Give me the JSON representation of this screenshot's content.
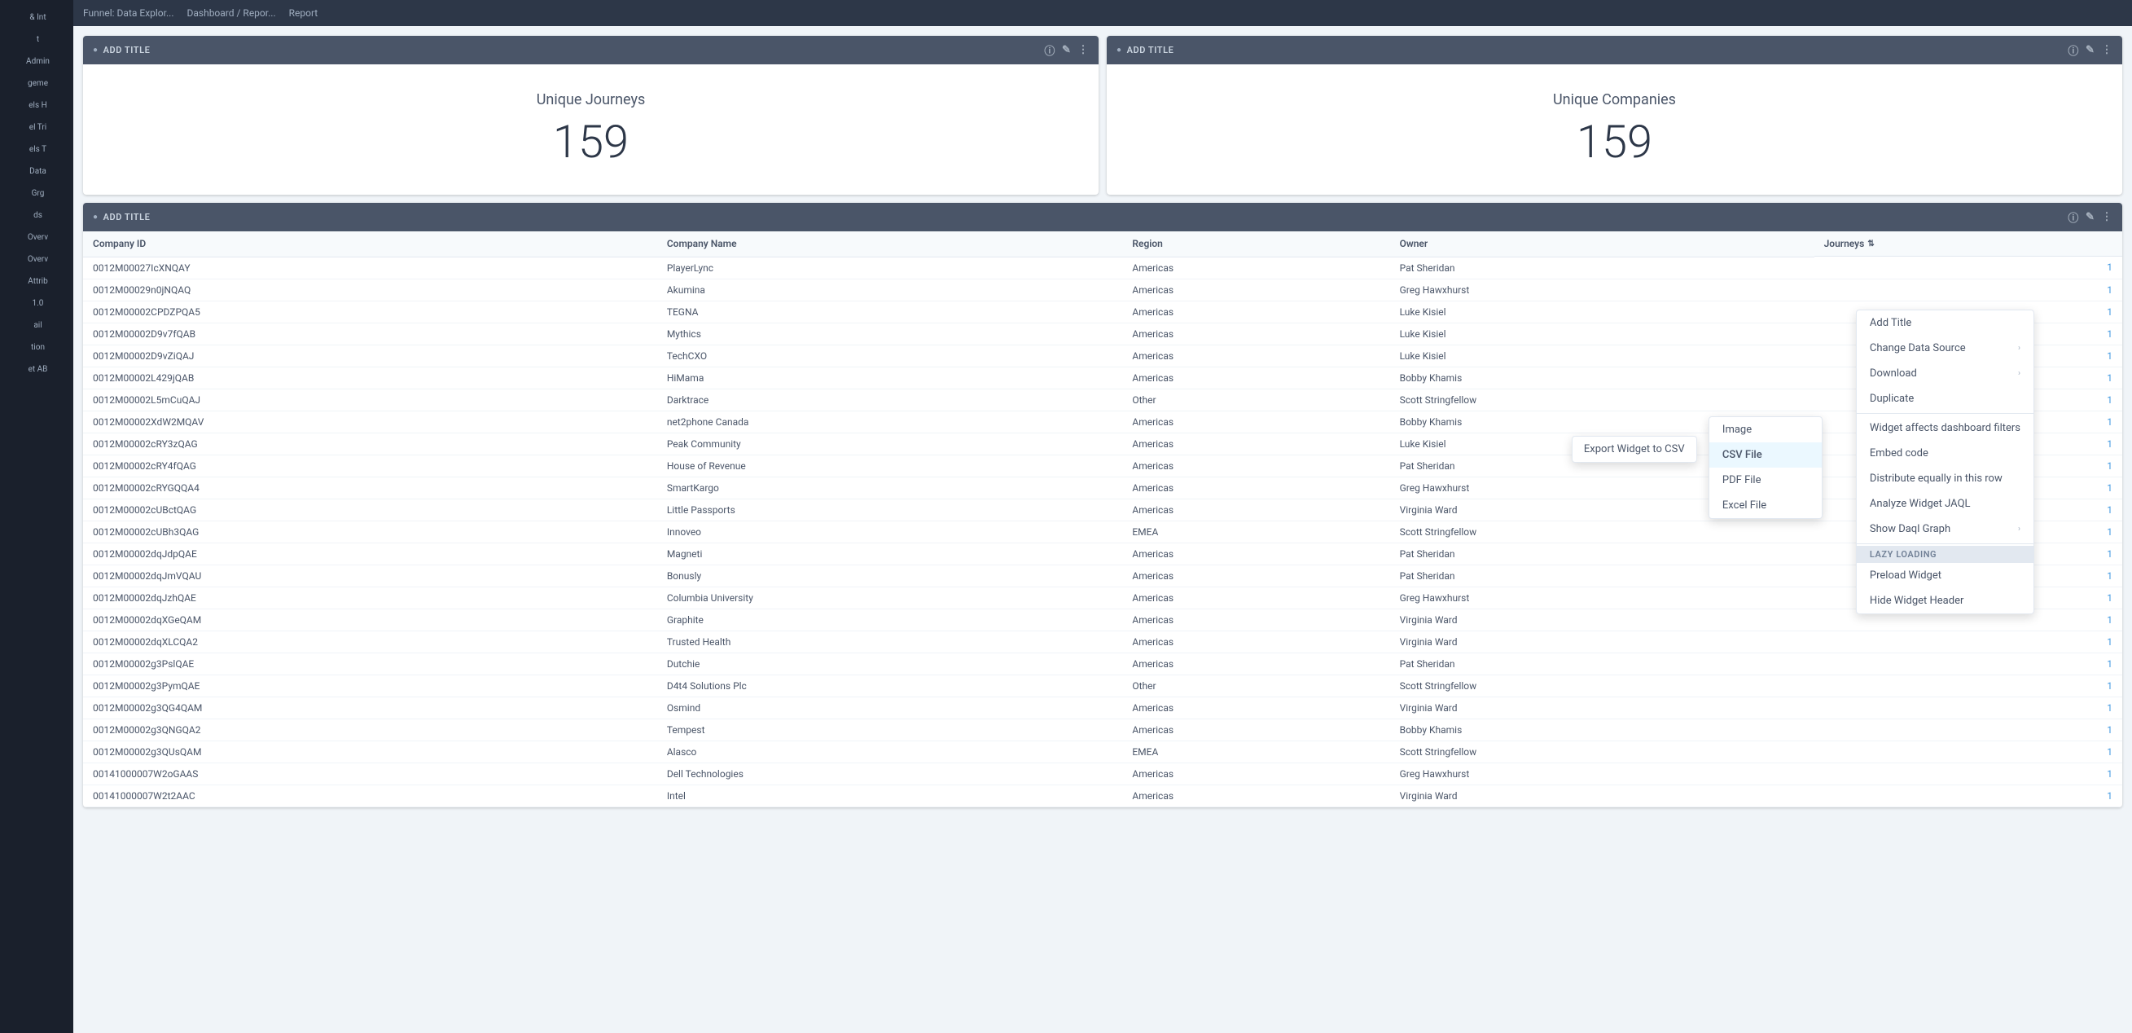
{
  "sidebar": {
    "items": [
      {
        "label": "& Int",
        "id": "int"
      },
      {
        "label": "t",
        "id": "t"
      },
      {
        "label": "Admin",
        "id": "admin"
      },
      {
        "label": "geme",
        "id": "geme"
      },
      {
        "label": "els H",
        "id": "elsh"
      },
      {
        "label": "el Tri",
        "id": "eltri"
      },
      {
        "label": "els T",
        "id": "elst"
      },
      {
        "label": "Data",
        "id": "data"
      },
      {
        "label": "Grg",
        "id": "grg"
      },
      {
        "label": "ds",
        "id": "ds"
      },
      {
        "label": "Overv",
        "id": "overv"
      },
      {
        "label": "Overv",
        "id": "overv2"
      },
      {
        "label": "Attrib",
        "id": "attrib"
      },
      {
        "label": "1.0",
        "id": "v1"
      },
      {
        "label": "ail",
        "id": "ail"
      },
      {
        "label": "tion",
        "id": "tion"
      },
      {
        "label": "et AB",
        "id": "etab"
      }
    ]
  },
  "topBar": {
    "tabs": [
      "Funnel: Data Explor...",
      "Dashboard / Repor...",
      "Report"
    ]
  },
  "widgets": {
    "widget1": {
      "header": "ADD TITLE",
      "metricLabel": "Unique Journeys",
      "metricValue": "159"
    },
    "widget2": {
      "header": "ADD TITLE",
      "metricLabel": "Unique Companies",
      "metricValue": "159"
    },
    "tableWidget": {
      "header": "ADD TITLE",
      "columns": [
        "Company ID",
        "Company Name",
        "Region",
        "Owner",
        "Journeys"
      ],
      "rows": [
        [
          "0012M00027IcXNQAY",
          "PlayerLync",
          "Americas",
          "Pat Sheridan",
          "1"
        ],
        [
          "0012M00029n0jNQAQ",
          "Akumina",
          "Americas",
          "Greg Hawxhurst",
          "1"
        ],
        [
          "0012M00002CPDZPQA5",
          "TEGNA",
          "Americas",
          "Luke Kisiel",
          "1"
        ],
        [
          "0012M00002D9v7fQAB",
          "Mythics",
          "Americas",
          "Luke Kisiel",
          "1"
        ],
        [
          "0012M00002D9vZiQAJ",
          "TechCXO",
          "Americas",
          "Luke Kisiel",
          "1"
        ],
        [
          "0012M00002L429jQAB",
          "HiMama",
          "Americas",
          "Bobby Khamis",
          "1"
        ],
        [
          "0012M00002L5mCuQAJ",
          "Darktrace",
          "Other",
          "Scott Stringfellow",
          "1"
        ],
        [
          "0012M00002XdW2MQAV",
          "net2phone Canada",
          "Americas",
          "Bobby Khamis",
          "1"
        ],
        [
          "0012M00002cRY3zQAG",
          "Peak Community",
          "Americas",
          "Luke Kisiel",
          "1"
        ],
        [
          "0012M00002cRY4fQAG",
          "House of Revenue",
          "Americas",
          "Pat Sheridan",
          "1"
        ],
        [
          "0012M00002cRYGQQA4",
          "SmartKargo",
          "Americas",
          "Greg Hawxhurst",
          "1"
        ],
        [
          "0012M00002cUBctQAG",
          "Little Passports",
          "Americas",
          "Virginia Ward",
          "1"
        ],
        [
          "0012M00002cUBh3QAG",
          "Innoveo",
          "EMEA",
          "Scott Stringfellow",
          "1"
        ],
        [
          "0012M00002dqJdpQAE",
          "Magneti",
          "Americas",
          "Pat Sheridan",
          "1"
        ],
        [
          "0012M00002dqJmVQAU",
          "Bonusly",
          "Americas",
          "Pat Sheridan",
          "1"
        ],
        [
          "0012M00002dqJzhQAE",
          "Columbia University",
          "Americas",
          "Greg Hawxhurst",
          "1"
        ],
        [
          "0012M00002dqXGeQAM",
          "Graphite",
          "Americas",
          "Virginia Ward",
          "1"
        ],
        [
          "0012M00002dqXLCQA2",
          "Trusted Health",
          "Americas",
          "Virginia Ward",
          "1"
        ],
        [
          "0012M00002g3PslQAE",
          "Dutchie",
          "Americas",
          "Pat Sheridan",
          "1"
        ],
        [
          "0012M00002g3PymQAE",
          "D4t4 Solutions Plc",
          "Other",
          "Scott Stringfellow",
          "1"
        ],
        [
          "0012M00002g3QG4QAM",
          "Osmind",
          "Americas",
          "Virginia Ward",
          "1"
        ],
        [
          "0012M00002g3QNGQA2",
          "Tempest",
          "Americas",
          "Bobby Khamis",
          "1"
        ],
        [
          "0012M00002g3QUsQAM",
          "Alasco",
          "EMEA",
          "Scott Stringfellow",
          "1"
        ],
        [
          "00141000007W2oGAAS",
          "Dell Technologies",
          "Americas",
          "Greg Hawxhurst",
          "1"
        ],
        [
          "00141000007W2t2AAC",
          "Intel",
          "Americas",
          "Virginia Ward",
          "1"
        ]
      ]
    }
  },
  "contextMenu": {
    "items": [
      {
        "label": "Add Title",
        "id": "add-title",
        "hasArrow": false
      },
      {
        "label": "Change Data Source",
        "id": "change-data-source",
        "hasArrow": true
      },
      {
        "label": "Download",
        "id": "download",
        "hasArrow": true
      },
      {
        "label": "Duplicate",
        "id": "duplicate",
        "hasArrow": false
      },
      {
        "label": "Widget affects dashboard filters",
        "id": "widget-affects",
        "hasArrow": false
      },
      {
        "label": "Embed code",
        "id": "embed-code",
        "hasArrow": false
      },
      {
        "label": "Distribute equally in this row",
        "id": "distribute-equally",
        "hasArrow": false
      },
      {
        "label": "Analyze Widget JAQL",
        "id": "analyze-widget",
        "hasArrow": false
      },
      {
        "label": "Show Daql Graph",
        "id": "show-daql",
        "hasArrow": true
      }
    ],
    "lazyLoadingSection": {
      "header": "Lazy Loading",
      "items": [
        {
          "label": "Preload Widget",
          "id": "preload-widget"
        },
        {
          "label": "Hide Widget Header",
          "id": "hide-widget-header"
        }
      ]
    }
  },
  "downloadSubmenu": {
    "items": [
      {
        "label": "Image",
        "id": "image"
      },
      {
        "label": "CSV File",
        "id": "csv-file"
      },
      {
        "label": "PDF File",
        "id": "pdf-file"
      },
      {
        "label": "Excel File",
        "id": "excel-file"
      }
    ]
  },
  "exportTooltip": {
    "label": "Export Widget to CSV"
  }
}
